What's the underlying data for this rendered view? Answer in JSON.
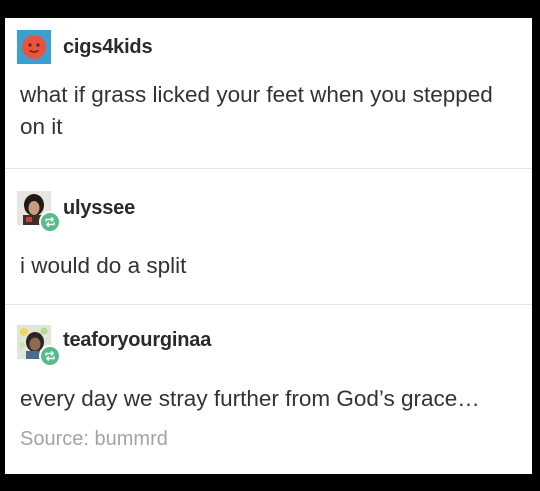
{
  "posts": [
    {
      "username": "cigs4kids",
      "text": "what if grass licked your feet when you stepped on it",
      "avatar_icon": "orange-face-avatar",
      "is_reblog": false
    },
    {
      "username": "ulyssee",
      "text": "i would do a split",
      "avatar_icon": "photo-avatar",
      "is_reblog": true,
      "badge_icon": "reblog-icon"
    },
    {
      "username": "teaforyourginaa",
      "text": "every day we stray further from God’s grace…",
      "avatar_icon": "photo-avatar",
      "is_reblog": true,
      "badge_icon": "reblog-icon"
    }
  ],
  "source": {
    "label": "Source:",
    "name": "bummrd"
  },
  "colors": {
    "background": "#000000",
    "card": "#ffffff",
    "reblog_badge": "#56bc8a",
    "avatar_bg": "#3aa0d0",
    "avatar_face": "#e8533f",
    "source_text": "#a3a3a3"
  }
}
